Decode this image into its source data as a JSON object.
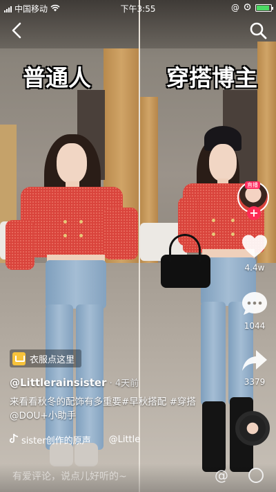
{
  "status_bar": {
    "carrier": "中国移动",
    "time": "下午3:55",
    "battery_percent": 90
  },
  "nav": {
    "back_icon": "chevron-left-icon",
    "search_icon": "search-icon"
  },
  "overlay": {
    "left_title": "普通人",
    "right_title": "穿搭博主"
  },
  "actions": {
    "avatar_tag": "直播",
    "like_count": "4.4w",
    "comment_count": "1044",
    "share_count": "3379"
  },
  "product": {
    "label": "衣服点这里"
  },
  "post": {
    "author": "@Littlerainsister",
    "time_sep": " · ",
    "time": "4天前",
    "description": "来看看秋冬的配饰有多重要#早秋搭配 #穿搭@DOU+小助手",
    "music_text": "sister创作的原声",
    "music_author": "@Little"
  },
  "comment_bar": {
    "placeholder": "有爱评论，说点儿好听的~"
  },
  "colors": {
    "like": "#ffffff",
    "follow": "#fe2c55",
    "jacket": "#d9443c",
    "battery": "#4cd964"
  }
}
